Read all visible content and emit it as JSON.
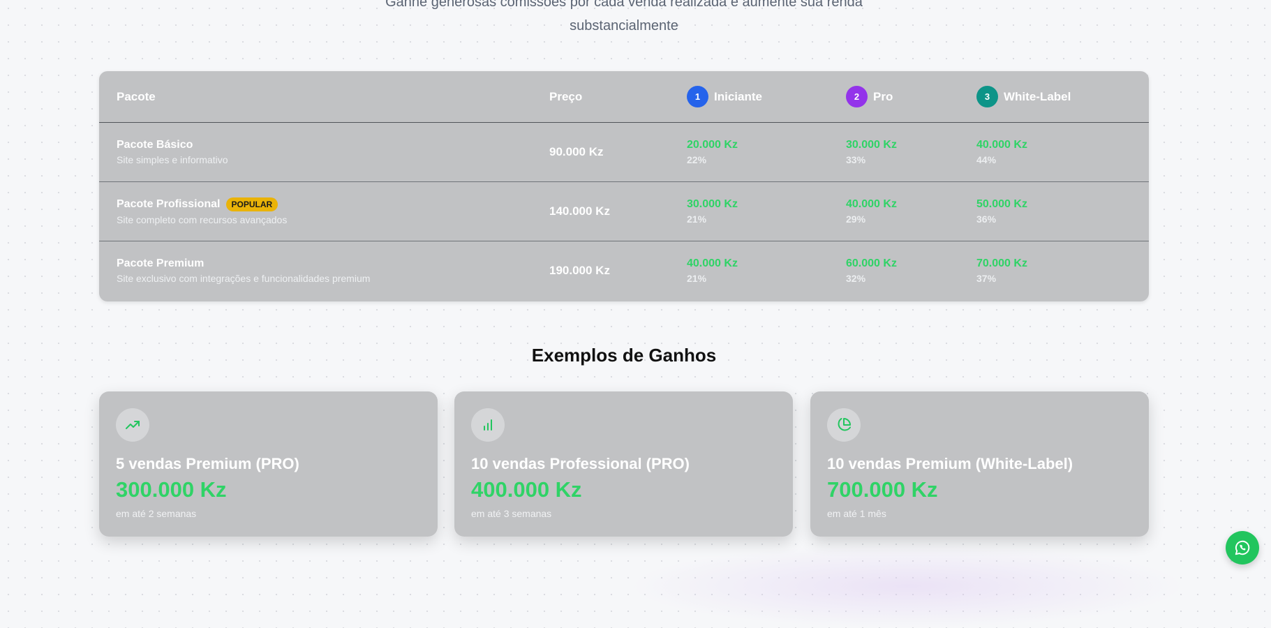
{
  "header": {
    "subtitle_line1": "Ganhe generosas comissões por cada venda realizada e aumente sua renda",
    "subtitle_line2": "substancialmente"
  },
  "commission_table": {
    "columns": {
      "package": "Pacote",
      "price": "Preço",
      "tiers": [
        {
          "number": "1",
          "label": "Iniciante",
          "color": "#2563eb"
        },
        {
          "number": "2",
          "label": "Pro",
          "color": "#9333ea"
        },
        {
          "number": "3",
          "label": "White-Label",
          "color": "#0d9488"
        }
      ]
    },
    "rows": [
      {
        "name": "Pacote Básico",
        "badge": "",
        "description": "Site simples e informativo",
        "price": "90.000 Kz",
        "commissions": [
          {
            "amount": "20.000 Kz",
            "percent": "22%"
          },
          {
            "amount": "30.000 Kz",
            "percent": "33%"
          },
          {
            "amount": "40.000 Kz",
            "percent": "44%"
          }
        ]
      },
      {
        "name": "Pacote Profissional",
        "badge": "POPULAR",
        "description": "Site completo com recursos avançados",
        "price": "140.000 Kz",
        "commissions": [
          {
            "amount": "30.000 Kz",
            "percent": "21%"
          },
          {
            "amount": "40.000 Kz",
            "percent": "29%"
          },
          {
            "amount": "50.000 Kz",
            "percent": "36%"
          }
        ]
      },
      {
        "name": "Pacote Premium",
        "badge": "",
        "description": "Site exclusivo com integrações e funcionalidades premium",
        "price": "190.000 Kz",
        "commissions": [
          {
            "amount": "40.000 Kz",
            "percent": "21%"
          },
          {
            "amount": "60.000 Kz",
            "percent": "32%"
          },
          {
            "amount": "70.000 Kz",
            "percent": "37%"
          }
        ]
      }
    ]
  },
  "examples": {
    "title": "Exemplos de Ganhos",
    "cards": [
      {
        "icon": "trending-up-icon",
        "title": "5 vendas Premium (PRO)",
        "amount": "300.000 Kz",
        "period": "em até 2 semanas"
      },
      {
        "icon": "bar-chart-icon",
        "title": "10 vendas Professional (PRO)",
        "amount": "400.000 Kz",
        "period": "em até 3 semanas"
      },
      {
        "icon": "pie-chart-icon",
        "title": "10 vendas Premium (White-Label)",
        "amount": "700.000 Kz",
        "period": "em até 1 mês"
      }
    ]
  },
  "floating": {
    "whatsapp_icon": "whatsapp-icon"
  },
  "colors": {
    "accent_green": "#2fd366",
    "badge_yellow": "#eab308",
    "whatsapp_green": "#22c55e"
  }
}
